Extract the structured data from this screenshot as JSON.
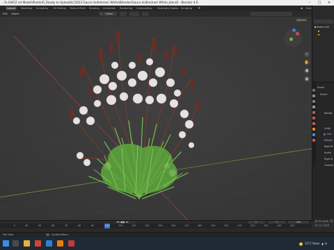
{
  "window": {
    "title": "...% OWCZ (st Model\\Plants\\Fi_Ready to Upload\\LC2023 Gaura lindheimeri White\\Blender\\Gaura lindheimeri White_blend] - Blender 4.0"
  },
  "workspaces": [
    "Layout",
    "Modeling",
    "Sculpting",
    "UV Editing",
    "Texture Paint",
    "Shading",
    "Animation",
    "Rendering",
    "Compositing",
    "Geometry Nodes",
    "Scripting"
  ],
  "active_workspace": "Layout",
  "scene_label": "Scene",
  "header": {
    "mode": "Edit",
    "object_menu": "Object",
    "orientation": "Global",
    "options": "Options"
  },
  "outliner": {
    "items": [
      "Scene Coll"
    ]
  },
  "properties": {
    "items": [
      "Scene",
      "Backgr",
      "Unity",
      "Can",
      "Simula",
      "Rigid B",
      "Audio",
      "Rigid D",
      "Custom"
    ]
  },
  "timeline": {
    "current_frame": "1",
    "start_frame": "1",
    "end_frame": "250",
    "ticks": [
      "0",
      "40",
      "50",
      "60",
      "70",
      "80",
      "90",
      "100",
      "110",
      "120",
      "130",
      "140",
      "150",
      "160",
      "170",
      "180",
      "190",
      "200",
      "210",
      "220",
      "230",
      "240",
      "250"
    ],
    "current_tick": "110"
  },
  "status": {
    "left": "Pan View",
    "center": "Context Menu"
  },
  "activate_windows": {
    "line1": "Activate W",
    "line2": "Go to Setti"
  },
  "taskbar": {
    "weather": "12°C Haze"
  },
  "colors": {
    "viewport_bg": "#3b3b3b",
    "x_axis": "#a4424a",
    "y_axis": "#7a9c3a",
    "leaf_green": "#6fb64a",
    "flower_white": "#e6e0e0",
    "stem_brown": "#7a3a2a",
    "active_blue": "#3d6fc4"
  }
}
